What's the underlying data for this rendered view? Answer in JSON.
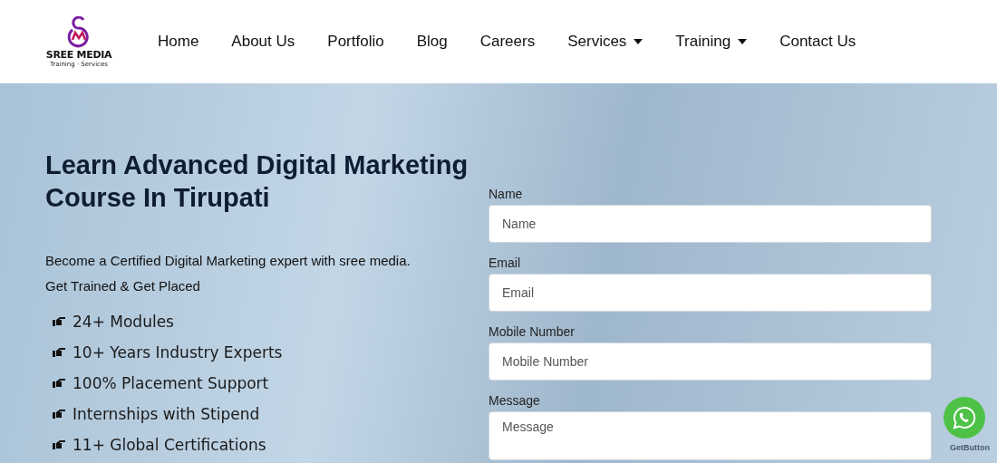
{
  "logo": {
    "name": "SREE MEDIA",
    "tagline": "Training · Services"
  },
  "nav": [
    {
      "label": "Home",
      "has_menu": false
    },
    {
      "label": "About Us",
      "has_menu": false
    },
    {
      "label": "Portfolio",
      "has_menu": false
    },
    {
      "label": "Blog",
      "has_menu": false
    },
    {
      "label": "Careers",
      "has_menu": false
    },
    {
      "label": "Services",
      "has_menu": true
    },
    {
      "label": "Training",
      "has_menu": true
    },
    {
      "label": "Contact Us",
      "has_menu": false
    }
  ],
  "hero": {
    "title": "Learn Advanced Digital Marketing Course In Tirupati",
    "description": "Become a Certified Digital Marketing expert with sree media. Get Trained & Get Placed",
    "features": [
      "24+ Modules",
      "10+ Years Industry Experts",
      "100% Placement Support",
      "Internships with Stipend",
      "11+ Global Certifications"
    ]
  },
  "form": {
    "fields": [
      {
        "label": "Name",
        "placeholder": "Name",
        "kind": "input"
      },
      {
        "label": "Email",
        "placeholder": "Email",
        "kind": "input"
      },
      {
        "label": "Mobile Number",
        "placeholder": "Mobile Number",
        "kind": "input"
      },
      {
        "label": "Message",
        "placeholder": "Message",
        "kind": "textarea"
      }
    ]
  },
  "chat_widget": {
    "caption": "GetButton"
  }
}
